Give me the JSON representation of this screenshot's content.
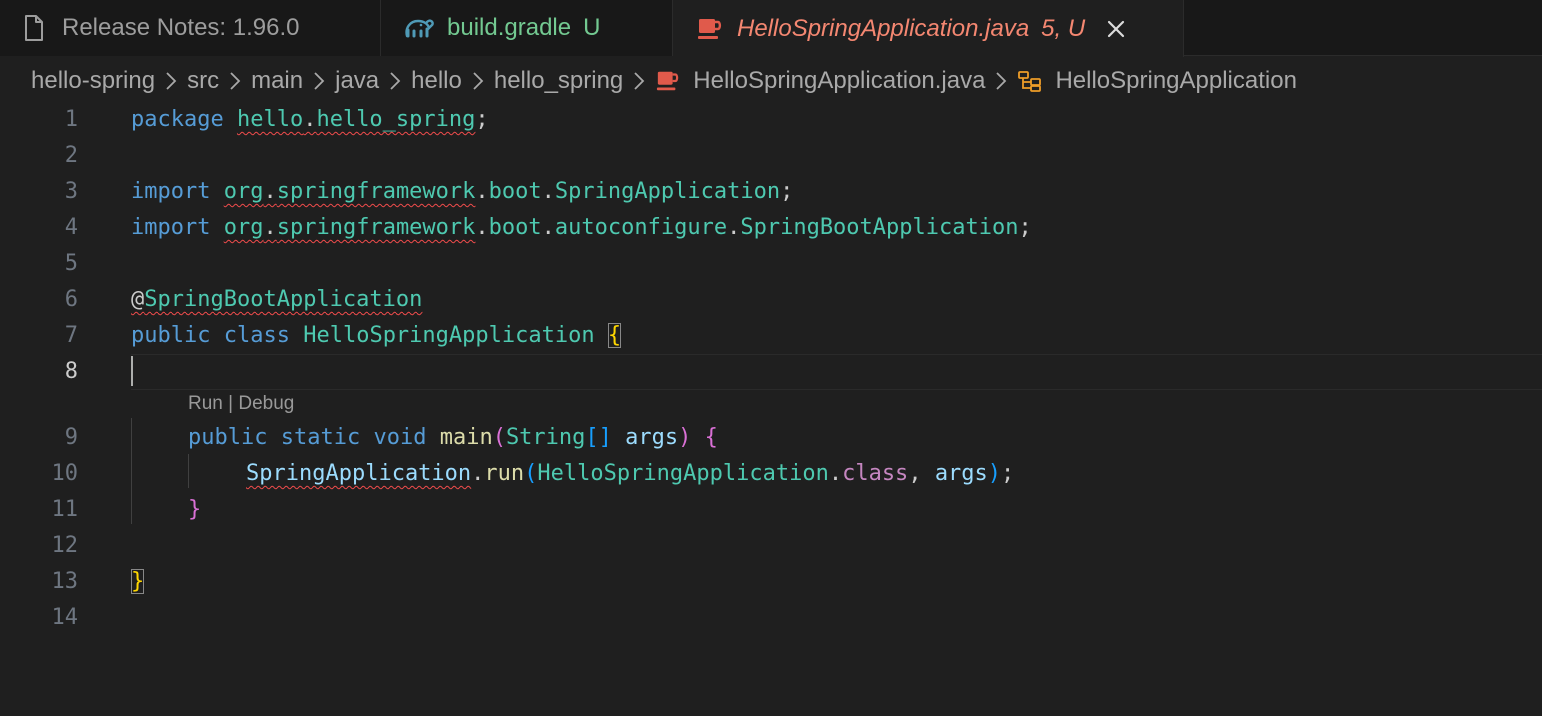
{
  "tabs": [
    {
      "label": "Release Notes: 1.96.0",
      "icon": "file-icon",
      "status": ""
    },
    {
      "label": "build.gradle",
      "icon": "gradle-elephant-icon",
      "status": "U"
    },
    {
      "label": "HelloSpringApplication.java",
      "icon": "java-cup-icon",
      "status": "5, U",
      "active": true
    }
  ],
  "breadcrumb": {
    "items": [
      "hello-spring",
      "src",
      "main",
      "java",
      "hello",
      "hello_spring",
      "HelloSpringApplication.java",
      "HelloSpringApplication"
    ]
  },
  "codelens": {
    "run": "Run",
    "separator": " | ",
    "debug": "Debug"
  },
  "line_numbers": [
    "1",
    "2",
    "3",
    "4",
    "5",
    "6",
    "7",
    "8",
    "9",
    "10",
    "11",
    "12",
    "13",
    "14"
  ],
  "code": {
    "l1": {
      "kw": "package",
      "a": "hello",
      "dot": ".",
      "b": "hello_spring",
      "semi": ";"
    },
    "l3": {
      "kw": "import",
      "a": "org",
      "b": "springframework",
      "c": "boot",
      "d": "SpringApplication",
      "dot": ".",
      "semi": ";"
    },
    "l4": {
      "kw": "import",
      "a": "org",
      "b": "springframework",
      "c": "boot",
      "d": "autoconfigure",
      "e": "SpringBootApplication",
      "dot": ".",
      "semi": ";"
    },
    "l6": {
      "at": "@",
      "ann": "SpringBootApplication"
    },
    "l7": {
      "kw1": "public",
      "kw2": "class",
      "name": "HelloSpringApplication",
      "brace": "{"
    },
    "l9": {
      "kw1": "public",
      "kw2": "static",
      "kw3": "void",
      "fn": "main",
      "p1": "(",
      "type": "String",
      "arr": "[]",
      "arg": "args",
      "p2": ")",
      "brace": "{"
    },
    "l10": {
      "cls": "SpringApplication",
      "dot": ".",
      "fn": "run",
      "p1": "(",
      "arg1": "HelloSpringApplication",
      "kw": "class",
      "comma": ", ",
      "arg2": "args",
      "p2": ")",
      "semi": ";"
    },
    "l11": {
      "brace": "}"
    },
    "l13": {
      "brace": "}"
    }
  },
  "colors": {
    "background": "#1f1f1f",
    "tab_bar": "#181818",
    "keyword": "#569cd6",
    "type": "#4ec9b0",
    "function": "#dcdcaa",
    "variable": "#9cdcfe",
    "error": "#f14c4c",
    "untracked": "#73c991",
    "modified_error": "#f48771"
  }
}
